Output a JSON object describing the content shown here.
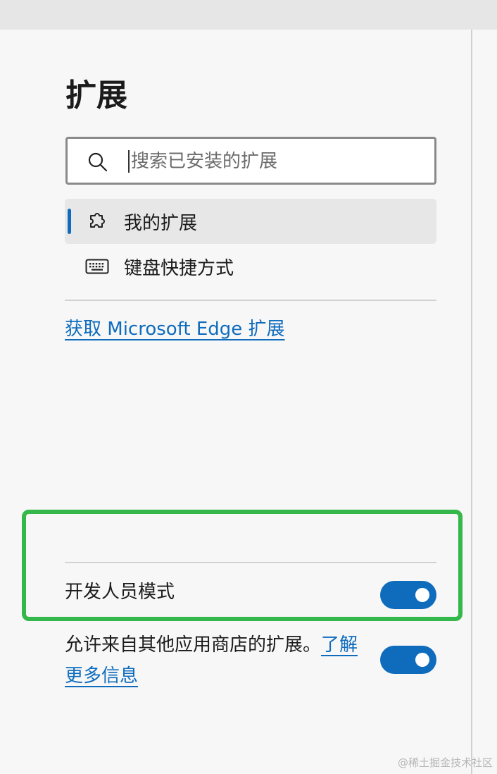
{
  "page": {
    "title": "扩展"
  },
  "search": {
    "placeholder": "搜索已安装的扩展",
    "value": "",
    "icon": "search-icon"
  },
  "nav": {
    "items": [
      {
        "label": "我的扩展",
        "icon": "puzzle-piece-icon",
        "active": true
      },
      {
        "label": "键盘快捷方式",
        "icon": "keyboard-icon",
        "active": false
      }
    ]
  },
  "get_extensions_link": "获取 Microsoft Edge 扩展",
  "settings": {
    "developer_mode": {
      "label": "开发人员模式",
      "enabled": true
    },
    "other_stores": {
      "label": "允许来自其他应用商店的扩展。",
      "link_text": "了解更多信息",
      "enabled": true
    }
  },
  "watermark": "@稀土掘金技术社区",
  "colors": {
    "accent": "#0f6cbd",
    "highlight_border": "#35b84b",
    "background": "#f7f7f7"
  }
}
